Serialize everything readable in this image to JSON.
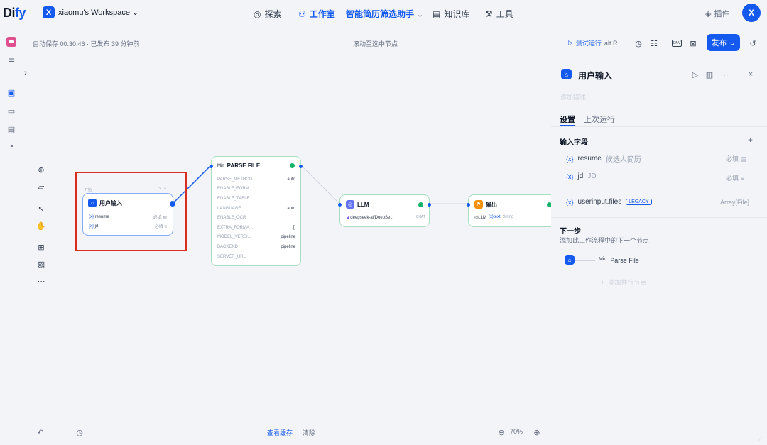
{
  "header": {
    "logo_main": "Di",
    "logo_accent": "fy",
    "workspace_initial": "X",
    "workspace_name": "xiaomu's Workspace",
    "nav": {
      "explore": "探索",
      "studio": "工作室",
      "app_name": "智能简历筛选助手",
      "knowledge": "知识库",
      "tools": "工具"
    },
    "plugin": "插件",
    "avatar_initial": "X"
  },
  "toolbar": {
    "autosave": "自动保存 00:30:46 · 已发布 39 分钟前",
    "scroll_to_selected": "滚动至选中节点",
    "test_run": "测试运行",
    "test_run_shortcut": "alt R",
    "env_label": "ENV",
    "publish": "发布"
  },
  "canvas": {
    "start_node": {
      "caption": "开始",
      "title": "用户输入",
      "fields": [
        {
          "name": "resume",
          "req": "必填"
        },
        {
          "name": "jd",
          "req": "必填"
        }
      ]
    },
    "parse_node": {
      "prefix": "Min",
      "title": "PARSE FILE",
      "params": [
        {
          "k": "PARSE_METHOD",
          "v": "auto"
        },
        {
          "k": "ENABLE_FORM...",
          "v": ""
        },
        {
          "k": "ENABLE_TABLE",
          "v": ""
        },
        {
          "k": "LANGUAGE",
          "v": "auto"
        },
        {
          "k": "ENABLE_OCR",
          "v": ""
        },
        {
          "k": "EXTRA_FORMA...",
          "v": "[]"
        },
        {
          "k": "MODEL_VERSI...",
          "v": "pipeline"
        },
        {
          "k": "BACKEND",
          "v": "pipeline"
        },
        {
          "k": "SERVER_URL",
          "v": ""
        }
      ]
    },
    "llm_node": {
      "title": "LLM",
      "model": "deepseek-ai/DeepSe...",
      "mode": "CHAT"
    },
    "output_node": {
      "title": "输出",
      "ref": "LLM",
      "var": "text",
      "type": "String"
    }
  },
  "panel": {
    "title": "用户输入",
    "desc_placeholder": "添加描述...",
    "tabs": [
      "设置",
      "上次运行"
    ],
    "input_fields_title": "输入字段",
    "variables": [
      {
        "name": "resume",
        "desc": "候选人简历",
        "req": "必填"
      },
      {
        "name": "jd",
        "desc": "JD",
        "req": "必填"
      }
    ],
    "sys_var": {
      "name": "userinput.files",
      "badge": "LEGACY",
      "type": "Array[File]"
    },
    "next_step_title": "下一步",
    "next_step_desc": "添加此工作流程中的下一个节点",
    "next_node_prefix": "Min",
    "next_node": "Parse File",
    "add_parallel": "添加并行节点"
  },
  "bottom": {
    "view_cache": "查看缓存",
    "clear": "清除",
    "zoom": "70%"
  },
  "colors": {
    "accent": "#155aef",
    "success": "#17b26a",
    "highlight": "#d92d20"
  }
}
